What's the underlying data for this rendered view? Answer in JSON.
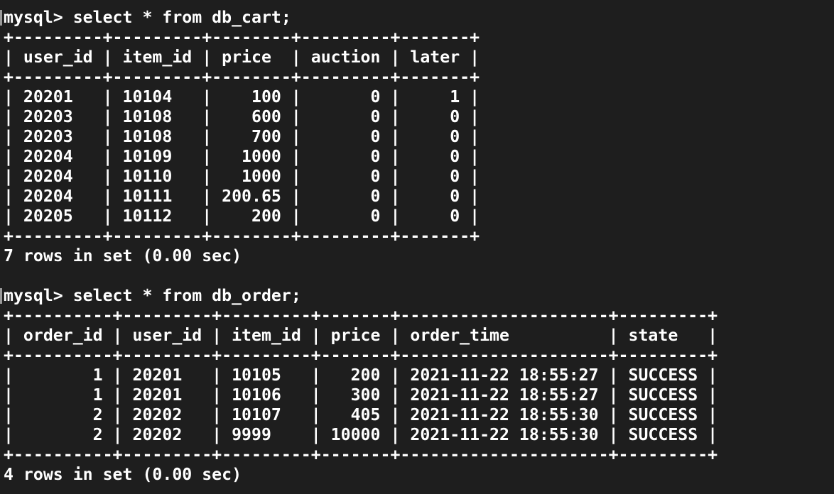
{
  "terminal": {
    "lines": [
      "mysql> select * from db_cart;",
      "+---------+---------+--------+---------+-------+",
      "| user_id | item_id | price  | auction | later |",
      "+---------+---------+--------+---------+-------+",
      "| 20201   | 10104   |    100 |       0 |     1 |",
      "| 20203   | 10108   |    600 |       0 |     0 |",
      "| 20203   | 10108   |    700 |       0 |     0 |",
      "| 20204   | 10109   |   1000 |       0 |     0 |",
      "| 20204   | 10110   |   1000 |       0 |     0 |",
      "| 20204   | 10111   | 200.65 |       0 |     0 |",
      "| 20205   | 10112   |    200 |       0 |     0 |",
      "+---------+---------+--------+---------+-------+",
      "7 rows in set (0.00 sec)",
      "",
      "mysql> select * from db_order;",
      "+----------+---------+---------+-------+---------------------+---------+",
      "| order_id | user_id | item_id | price | order_time          | state   |",
      "+----------+---------+---------+-------+---------------------+---------+",
      "|        1 | 20201   | 10105   |   200 | 2021-11-22 18:55:27 | SUCCESS |",
      "|        1 | 20201   | 10106   |   300 | 2021-11-22 18:55:27 | SUCCESS |",
      "|        2 | 20202   | 10107   |   405 | 2021-11-22 18:55:30 | SUCCESS |",
      "|        2 | 20202   | 9999    | 10000 | 2021-11-22 18:55:30 | SUCCESS |",
      "+----------+---------+---------+-------+---------------------+---------+",
      "4 rows in set (0.00 sec)"
    ]
  }
}
